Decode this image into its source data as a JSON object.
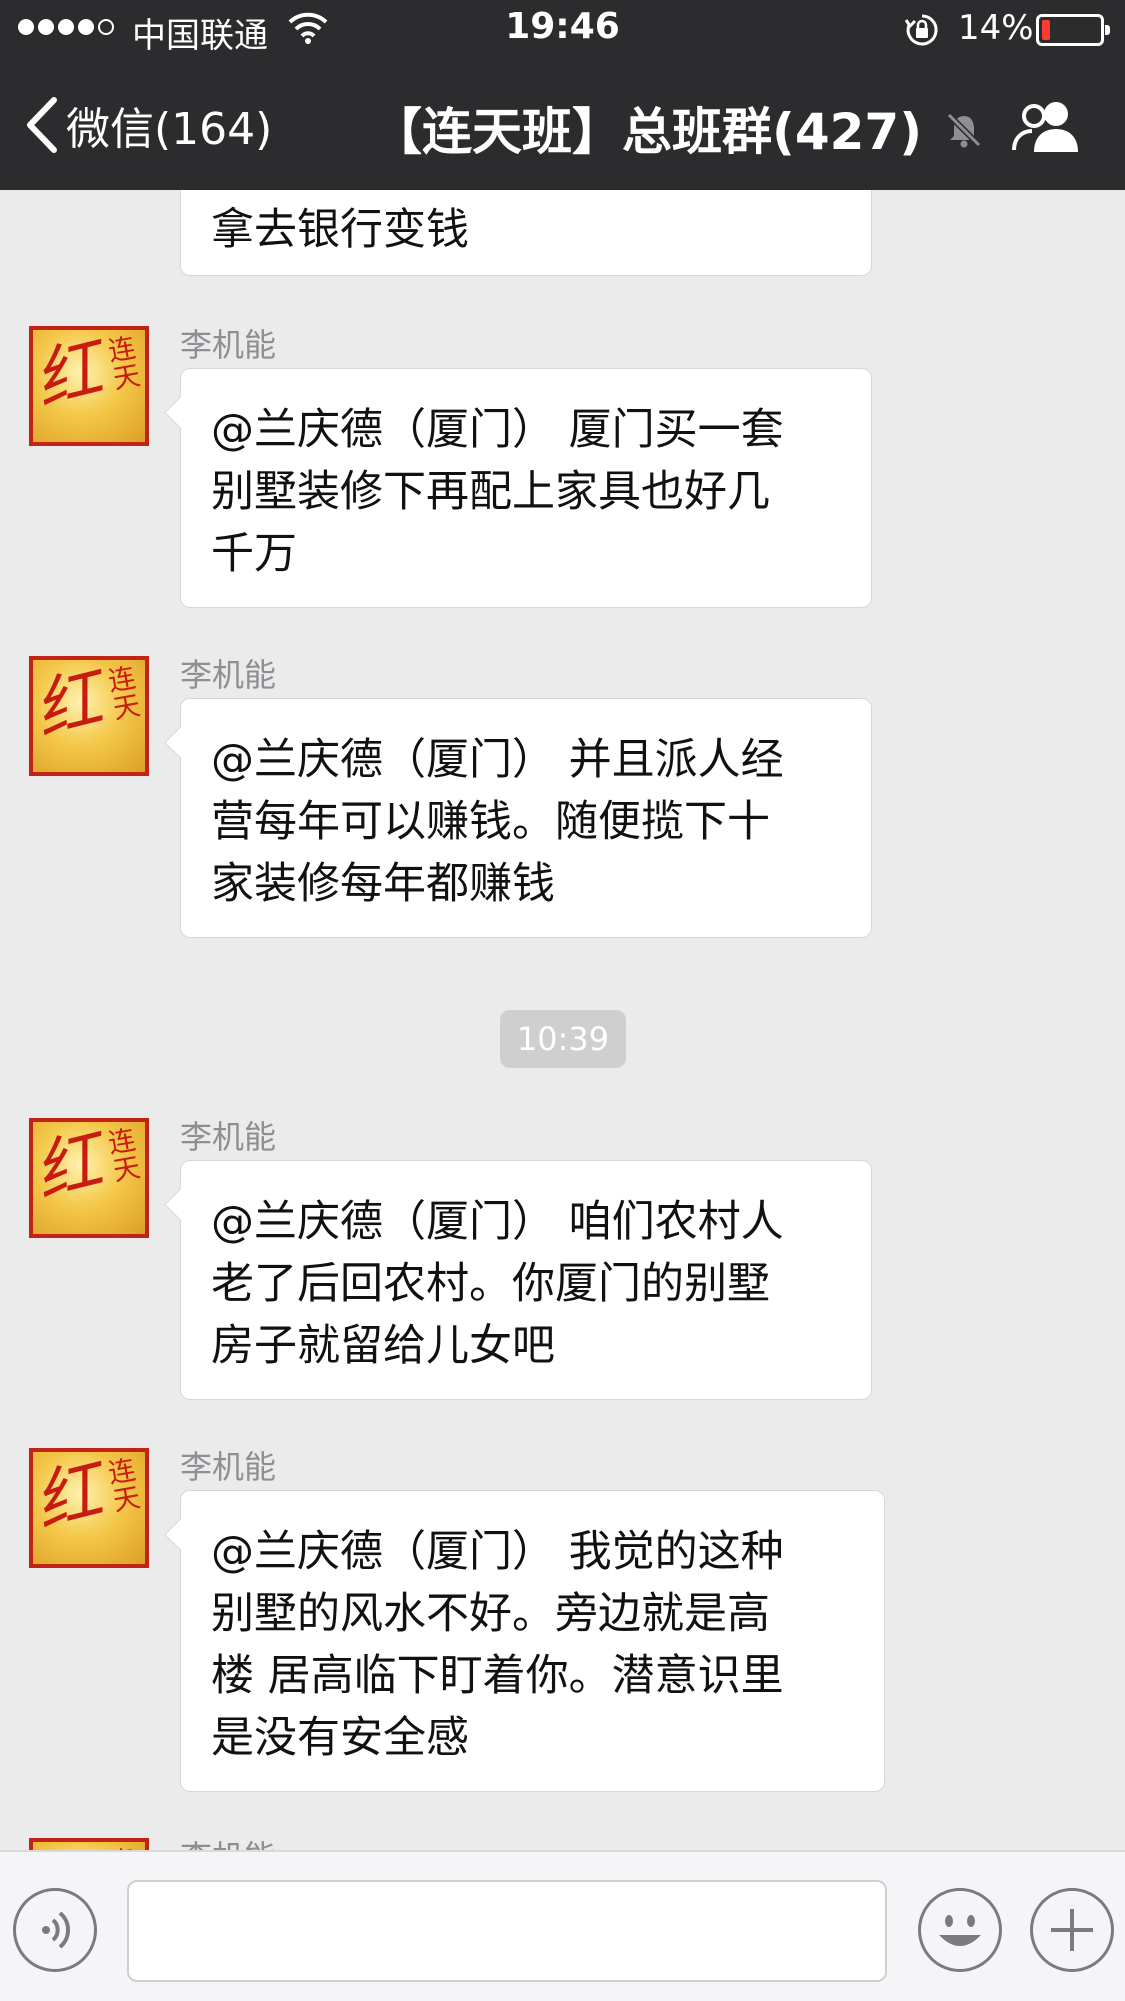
{
  "status_bar": {
    "carrier": "中国联通",
    "time": "19:46",
    "battery": "14%",
    "battery_color": "#ff3b30"
  },
  "navbar": {
    "back_label": "微信(164)",
    "title": "【连天班】总班群(427)",
    "icons": [
      "chevron-left-icon",
      "mute-bell-icon",
      "group-members-icon"
    ]
  },
  "chat": {
    "partial_top_message": "拿去银行变钱",
    "avatar_text": {
      "main": "红",
      "side": "连天"
    },
    "messages": [
      {
        "sender": "李机能",
        "lines": [
          "@兰庆德（厦门） 厦门买一套",
          "别墅装修下再配上家具也好几",
          "千万"
        ]
      },
      {
        "sender": "李机能",
        "lines": [
          "@兰庆德（厦门） 并且派人经",
          "营每年可以赚钱。随便揽下十",
          "家装修每年都赚钱"
        ]
      },
      {
        "sender": "李机能",
        "lines": [
          "@兰庆德（厦门） 咱们农村人",
          "老了后回农村。你厦门的别墅",
          "房子就留给儿女吧"
        ]
      },
      {
        "sender": "李机能",
        "lines": [
          " @兰庆德（厦门） 我觉的这种",
          "别墅的风水不好。旁边就是高",
          "楼 居高临下盯着你。潜意识里",
          "是没有安全感"
        ]
      },
      {
        "sender": "李机能"
      }
    ],
    "timestamp": "10:39"
  },
  "input_bar": {
    "text_value": "",
    "icons": [
      "voice-icon",
      "emoji-icon",
      "plus-icon"
    ]
  }
}
